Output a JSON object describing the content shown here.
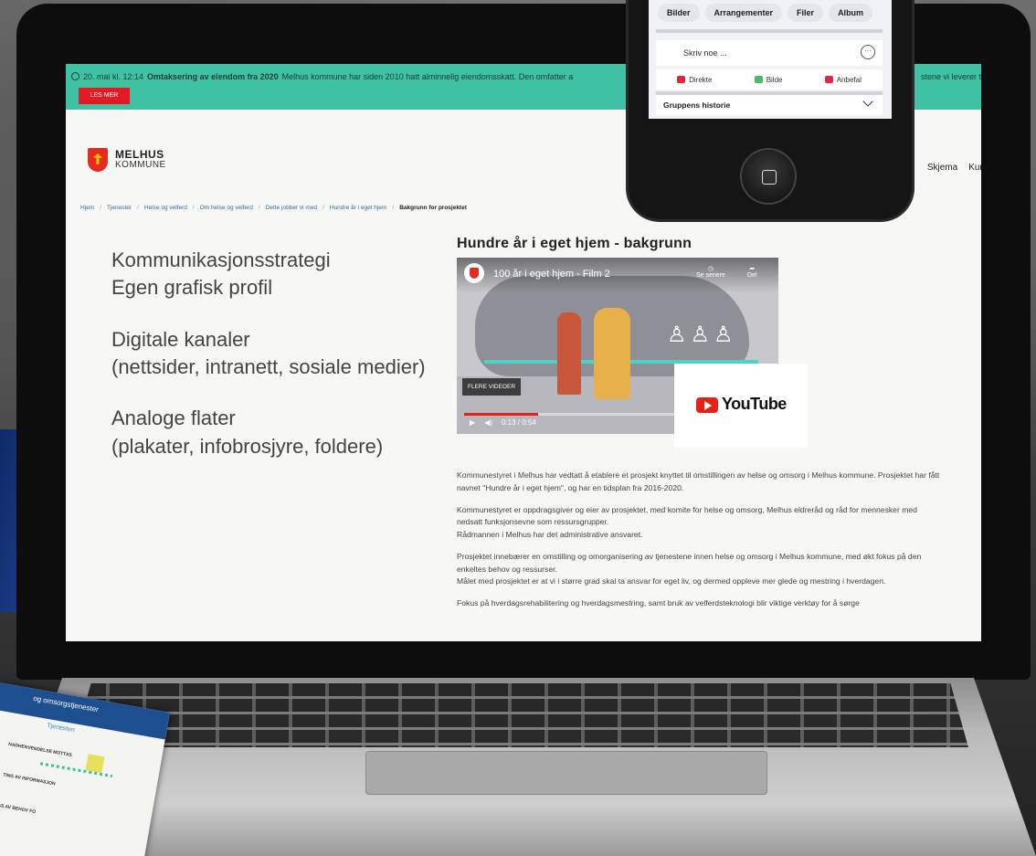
{
  "banner": {
    "date": "20. mai kl. 12:14",
    "headline": "Omtaksering av eiendom fra 2020",
    "text": "Melhus kommune har siden 2010 hatt alminnelig eiendomsskatt. Den omfatter a",
    "right_text": "stene vi leverer t",
    "button_label": "LES MER"
  },
  "logo": {
    "name": "MELHUS",
    "sub": "KOMMUNE"
  },
  "nav_right": [
    "Skjema",
    "Kun"
  ],
  "breadcrumb": [
    "Hjem",
    "Tjenester",
    "Helse og velferd",
    "Om helse og velferd",
    "Dette jobber vi med",
    "Hundre år i eget hjem",
    "Bakgrunn for prosjektet"
  ],
  "side": {
    "line1": "Kommunikasjonsstrategi",
    "line2": "Egen grafisk profil",
    "line3": "Digitale kanaler",
    "line4": "(nettsider, intranett, sosiale medier)",
    "line5": "Analoge flater",
    "line6": "(plakater, infobrosjyre, foldere)"
  },
  "article": {
    "title": "Hundre år i eget hjem - bakgrunn",
    "video": {
      "title": "100 år i eget hjem - Film 2",
      "watch_later": "Se senere",
      "share": "Del",
      "more_videos": "FLERE VIDEOER",
      "time": "0:13 / 0:54",
      "progress": 0.24,
      "youtube_label": "YouTube"
    },
    "paragraphs": [
      "Kommunestyret i Melhus har vedtatt å etablere et prosjekt knyttet til omstillingen av helse og omsorg i Melhus kommune. Prosjektet har fått navnet \"Hundre år i eget hjem\", og har en tidsplan fra 2016-2020.",
      "Kommunestyret er oppdragsgiver og eier av prosjektet, med komite for helse og omsorg, Melhus eldreråd og råd for mennesker med nedsatt funksjonsevne som ressursgrupper.\nRådmannen i Melhus har det administrative ansvaret.",
      "Prosjektet innebærer en omstilling og omorganisering av tjenestene innen helse og omsorg i Melhus kommune, med økt fokus på den enkeltes behov og ressurser.\nMålet med prosjektet er at vi i større grad skal ta ansvar for eget liv, og dermed oppleve mer glede og mestring i hverdagen.",
      "Fokus på hverdagsrehabilitering og hverdagsmestring, samt bruk av velferdsteknologi blir viktige verktøy for å sørge"
    ]
  },
  "phone": {
    "chips": [
      "Bilder",
      "Arrangementer",
      "Filer",
      "Album"
    ],
    "compose_placeholder": "Skriv noe ...",
    "actions": [
      "Direkte",
      "Bilde",
      "Anbefal"
    ],
    "history_title": "Gruppens historie"
  },
  "brochure": {
    "header": "og omsorgstjenester",
    "sub": "Tjenesten",
    "line1": "NADHENVENDELSE MOTTAS",
    "line2": "TING AV INFORMASJON",
    "line3": "AS AV BEHOV FO"
  }
}
